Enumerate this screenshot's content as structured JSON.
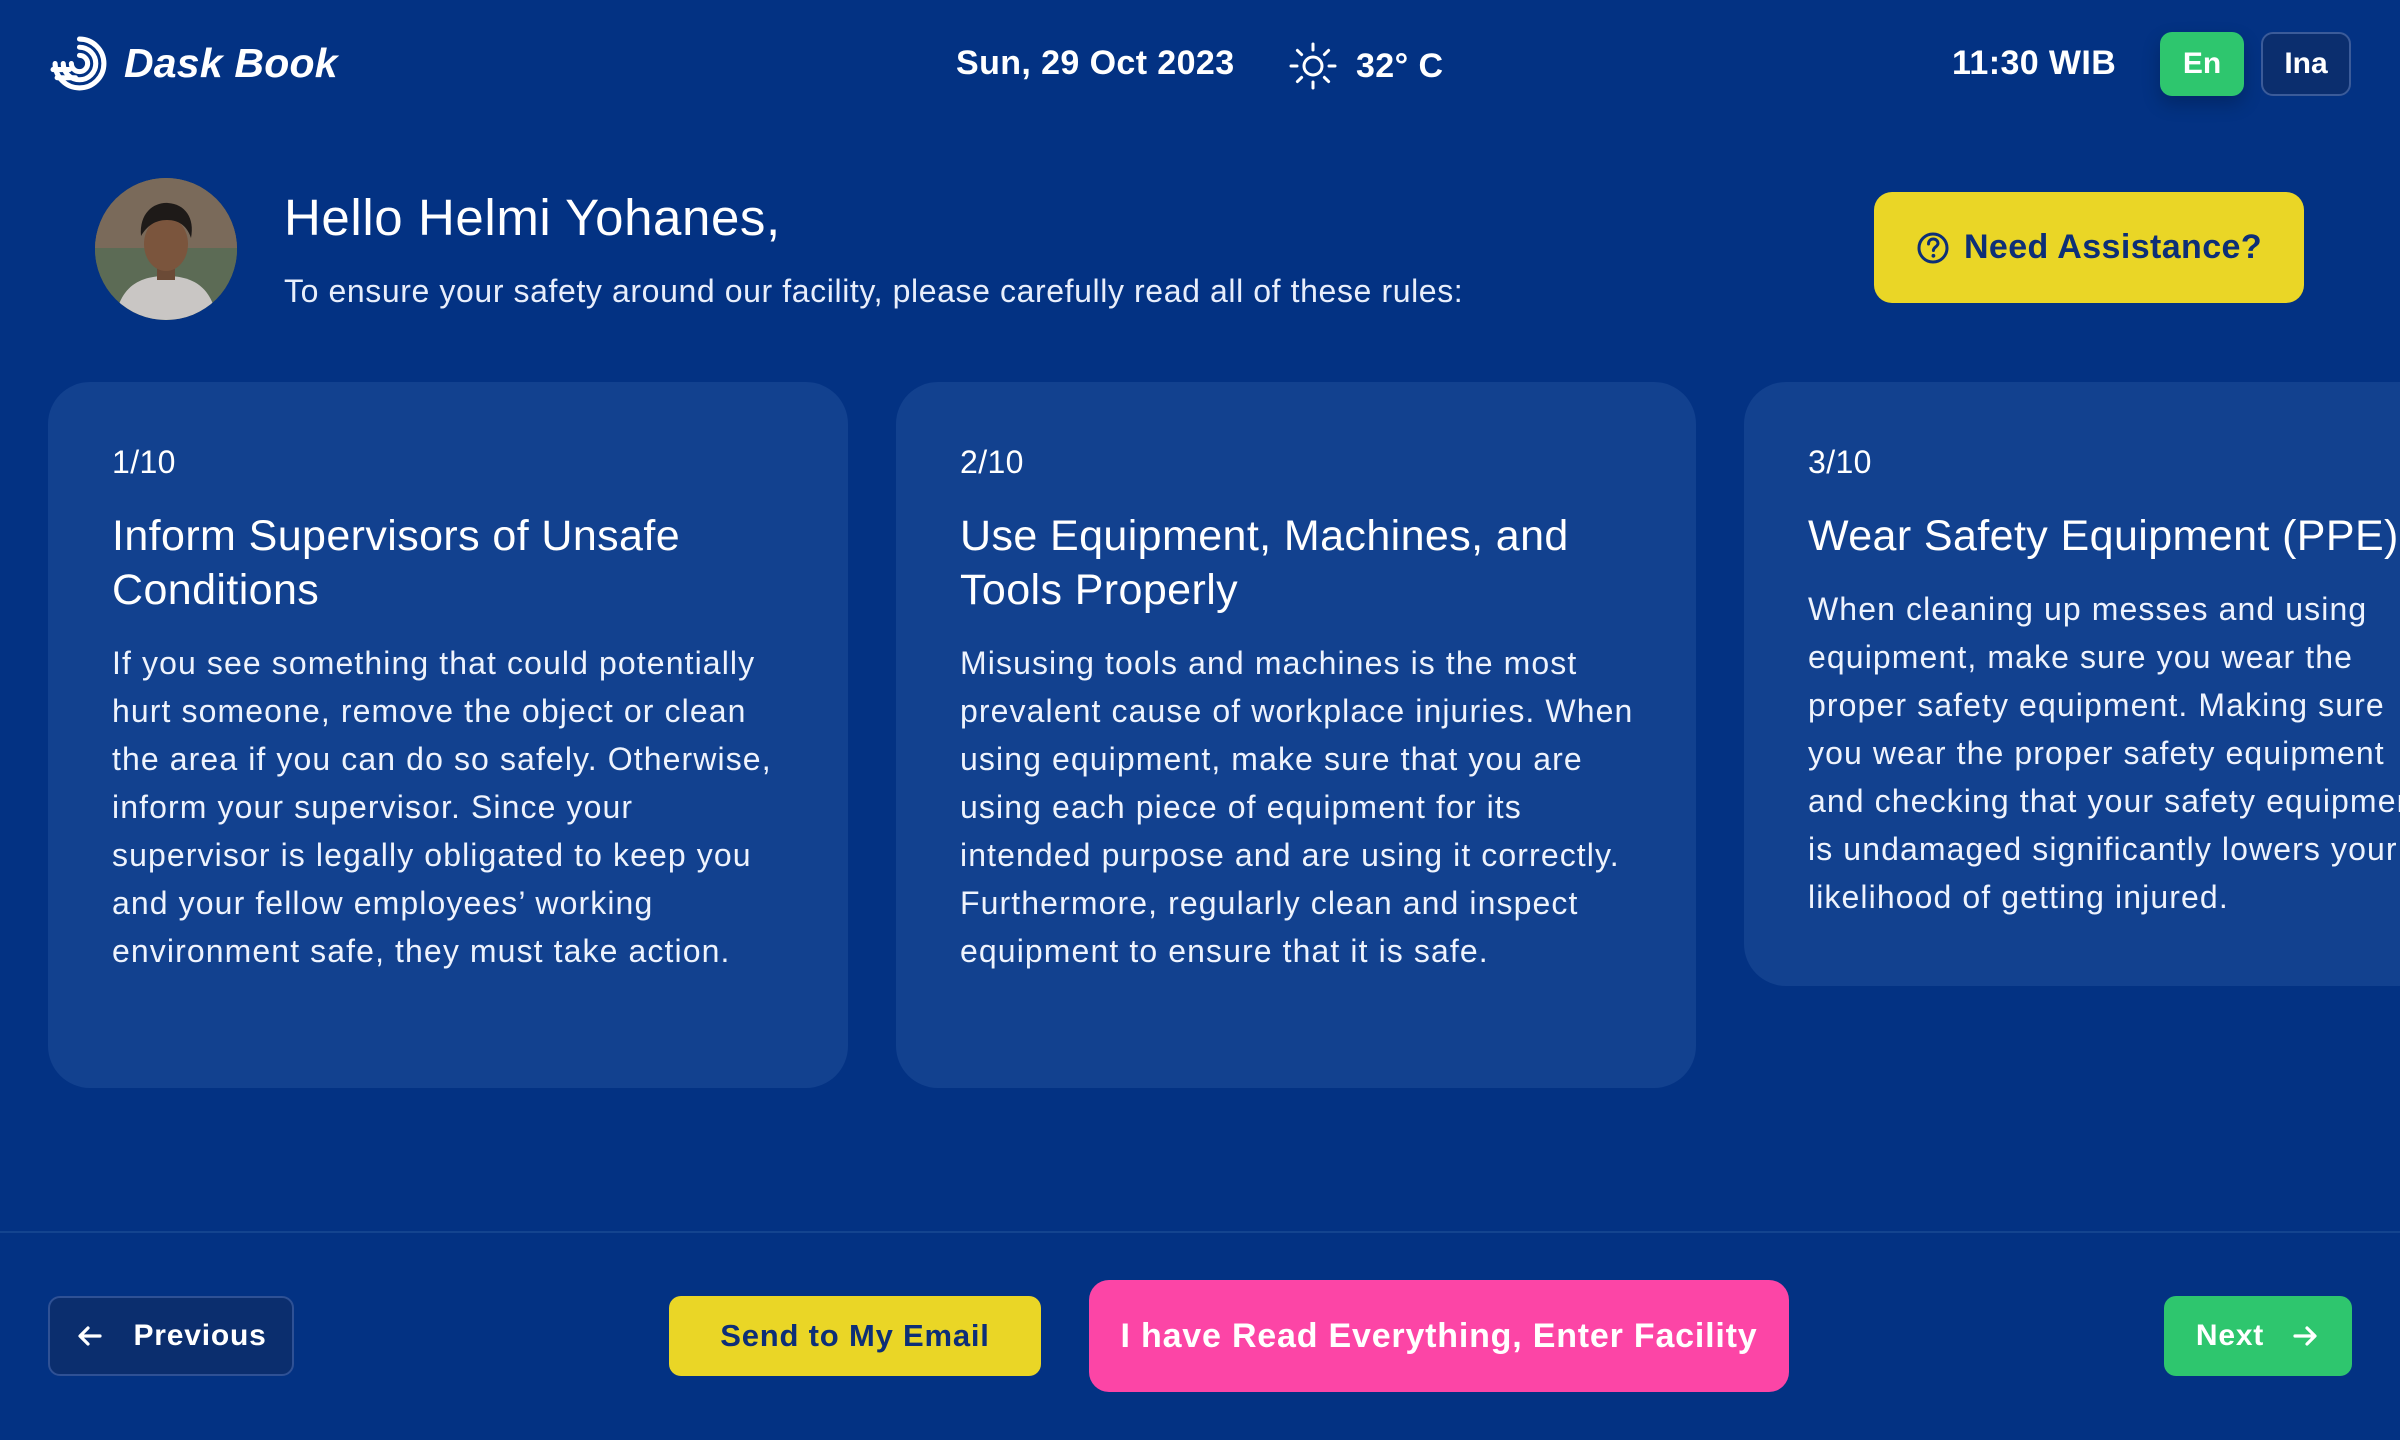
{
  "header": {
    "app_name": "Dask Book",
    "date": "Sun, 29 Oct 2023",
    "weather_icon": "sun-icon",
    "temperature": "32° C",
    "time": "11:30 WIB",
    "languages": [
      {
        "label": "En",
        "active": true
      },
      {
        "label": "Ina",
        "active": false
      }
    ]
  },
  "greeting": {
    "title": "Hello Helmi Yohanes,",
    "subtitle": "To ensure your safety around our facility, please carefully read all of these rules:",
    "assistance_label": "Need Assistance?"
  },
  "rules": [
    {
      "index": "1/10",
      "title": "Inform Supervisors of Unsafe Conditions",
      "body": "If you see something that could potentially hurt someone, remove the object or clean the area if you can do so safely. Otherwise, inform your supervisor. Since your supervisor is legally obligated to keep you and your fellow employees’ working environment safe, they must take action."
    },
    {
      "index": "2/10",
      "title": "Use Equipment, Machines, and Tools Properly",
      "body": "Misusing tools and machines is the most prevalent cause of workplace injuries. When using equipment, make sure that you are using each piece of equipment for its intended purpose and are using it correctly. Furthermore, regularly clean and inspect equipment to ensure that it is safe."
    },
    {
      "index": "3/10",
      "title": "Wear Safety Equipment (PPE)",
      "body_lines": [
        "When cleaning up messes and using",
        "equipment, make sure you wear the",
        "proper safety equipment. Making sure",
        "you wear the proper safety equipment",
        "and checking that your safety equipment",
        "is undamaged significantly lowers your",
        "likelihood of getting injured."
      ]
    }
  ],
  "footer": {
    "previous_label": "Previous",
    "email_label": "Send to My Email",
    "enter_label": "I have Read Everything, Enter Facility",
    "next_label": "Next"
  },
  "colors": {
    "background": "#033283",
    "card": "#12418f",
    "accent_yellow": "#ead626",
    "accent_pink": "#fc45a6",
    "accent_green": "#2ec66e"
  }
}
